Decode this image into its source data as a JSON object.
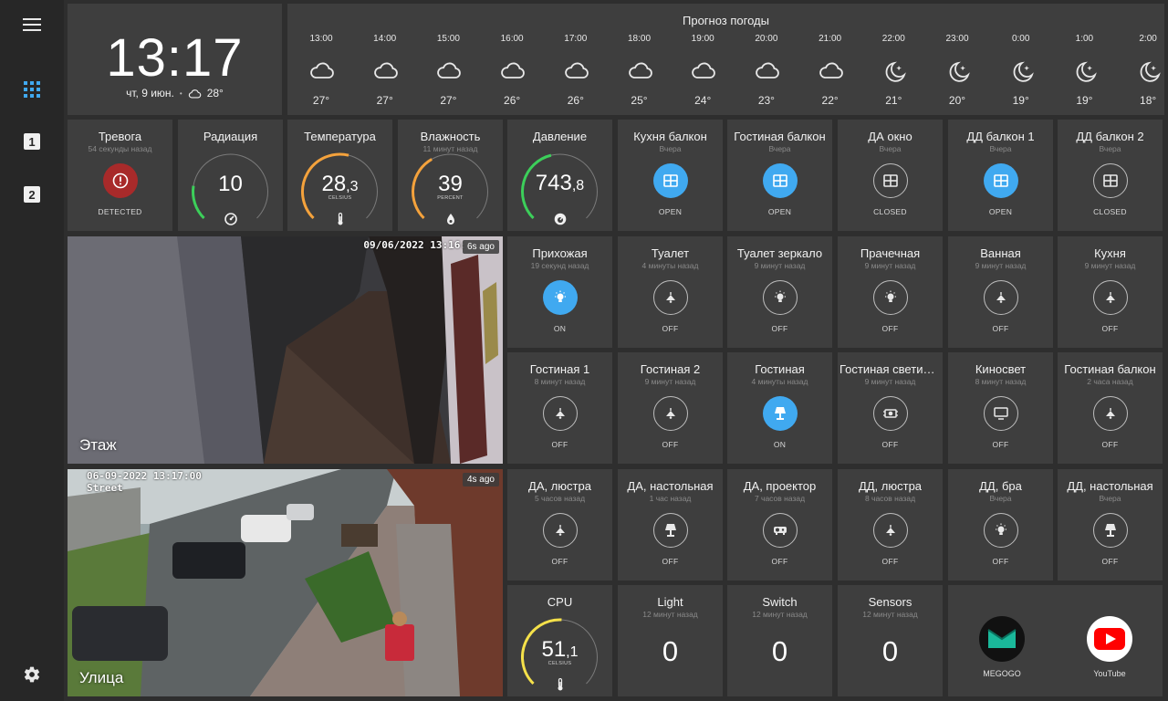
{
  "clock": {
    "time": "13:17",
    "date": "чт, 9 июн.",
    "temp": "28°"
  },
  "weather": {
    "title": "Прогноз погоды",
    "hours": [
      {
        "time": "13:00",
        "temp": "27°",
        "icon": "cloud"
      },
      {
        "time": "14:00",
        "temp": "27°",
        "icon": "cloud"
      },
      {
        "time": "15:00",
        "temp": "27°",
        "icon": "cloud"
      },
      {
        "time": "16:00",
        "temp": "26°",
        "icon": "cloud"
      },
      {
        "time": "17:00",
        "temp": "26°",
        "icon": "cloud"
      },
      {
        "time": "18:00",
        "temp": "25°",
        "icon": "cloud"
      },
      {
        "time": "19:00",
        "temp": "24°",
        "icon": "cloud"
      },
      {
        "time": "20:00",
        "temp": "23°",
        "icon": "cloud"
      },
      {
        "time": "21:00",
        "temp": "22°",
        "icon": "cloud"
      },
      {
        "time": "22:00",
        "temp": "21°",
        "icon": "moon"
      },
      {
        "time": "23:00",
        "temp": "20°",
        "icon": "moon"
      },
      {
        "time": "0:00",
        "temp": "19°",
        "icon": "moon"
      },
      {
        "time": "1:00",
        "temp": "19°",
        "icon": "moon"
      },
      {
        "time": "2:00",
        "temp": "18°",
        "icon": "moon"
      }
    ]
  },
  "sensors": {
    "alarm": {
      "title": "Тревога",
      "sub": "54 секунды назад",
      "state": "DETECTED"
    },
    "radiation": {
      "title": "Радиация",
      "value": "10",
      "level": 0.2
    },
    "temperature": {
      "title": "Температура",
      "value": "28",
      "decimal": ",3",
      "unit": "CELSIUS",
      "level": 0.55
    },
    "humidity": {
      "title": "Влажность",
      "sub": "11 минут назад",
      "value": "39",
      "unit": "PERCENT",
      "level": 0.39
    },
    "pressure": {
      "title": "Давление",
      "value": "743",
      "decimal": ",8",
      "level": 0.45
    },
    "cpu": {
      "title": "CPU",
      "value": "51",
      "decimal": ",1",
      "unit": "CELSIUS",
      "level": 0.51
    }
  },
  "windows": [
    {
      "title": "Кухня балкон",
      "sub": "Вчера",
      "state": "OPEN",
      "on": true
    },
    {
      "title": "Гостиная балкон",
      "sub": "Вчера",
      "state": "OPEN",
      "on": true
    },
    {
      "title": "ДА окно",
      "sub": "Вчера",
      "state": "CLOSED",
      "on": false
    },
    {
      "title": "ДД балкон 1",
      "sub": "Вчера",
      "state": "OPEN",
      "on": true
    },
    {
      "title": "ДД балкон 2",
      "sub": "Вчера",
      "state": "CLOSED",
      "on": false
    }
  ],
  "lights": [
    {
      "title": "Прихожая",
      "sub": "19 секунд назад",
      "state": "ON",
      "on": true,
      "icon": "bulb"
    },
    {
      "title": "Туалет",
      "sub": "4 минуты назад",
      "state": "OFF",
      "on": false,
      "icon": "ceiling"
    },
    {
      "title": "Туалет зеркало",
      "sub": "9 минут назад",
      "state": "OFF",
      "on": false,
      "icon": "bulb"
    },
    {
      "title": "Прачечная",
      "sub": "9 минут назад",
      "state": "OFF",
      "on": false,
      "icon": "bulb"
    },
    {
      "title": "Ванная",
      "sub": "9 минут назад",
      "state": "OFF",
      "on": false,
      "icon": "ceiling"
    },
    {
      "title": "Кухня",
      "sub": "9 минут назад",
      "state": "OFF",
      "on": false,
      "icon": "ceiling"
    },
    {
      "title": "Гостиная 1",
      "sub": "8 минут назад",
      "state": "OFF",
      "on": false,
      "icon": "ceiling"
    },
    {
      "title": "Гостиная 2",
      "sub": "9 минут назад",
      "state": "OFF",
      "on": false,
      "icon": "ceiling"
    },
    {
      "title": "Гостиная",
      "sub": "4 минуты назад",
      "state": "ON",
      "on": true,
      "icon": "lamp"
    },
    {
      "title": "Гостиная светильник",
      "sub": "9 минут назад",
      "state": "OFF",
      "on": false,
      "icon": "projector"
    },
    {
      "title": "Киносвет",
      "sub": "8 минут назад",
      "state": "OFF",
      "on": false,
      "icon": "tv"
    },
    {
      "title": "Гостиная балкон",
      "sub": "2 часа назад",
      "state": "OFF",
      "on": false,
      "icon": "ceiling"
    },
    {
      "title": "ДА, люстра",
      "sub": "5 часов назад",
      "state": "OFF",
      "on": false,
      "icon": "ceiling"
    },
    {
      "title": "ДА, настольная",
      "sub": "1 час назад",
      "state": "OFF",
      "on": false,
      "icon": "lamp"
    },
    {
      "title": "ДА, проектор",
      "sub": "7 часов назад",
      "state": "OFF",
      "on": false,
      "icon": "projector2"
    },
    {
      "title": "ДД, люстра",
      "sub": "8 часов назад",
      "state": "OFF",
      "on": false,
      "icon": "ceiling"
    },
    {
      "title": "ДД, бра",
      "sub": "Вчера",
      "state": "OFF",
      "on": false,
      "icon": "bulb"
    },
    {
      "title": "ДД, настольная",
      "sub": "Вчера",
      "state": "OFF",
      "on": false,
      "icon": "lamp"
    }
  ],
  "counters": [
    {
      "title": "Light",
      "sub": "12 минут назад",
      "value": "0"
    },
    {
      "title": "Switch",
      "sub": "12 минут назад",
      "value": "0"
    },
    {
      "title": "Sensors",
      "sub": "12 минут назад",
      "value": "0"
    }
  ],
  "apps": [
    {
      "name": "MEGOGO",
      "color": "#111111"
    },
    {
      "name": "YouTube",
      "color": "#ffffff"
    }
  ],
  "cameras": {
    "floor": {
      "label": "Этаж",
      "timestamp": "09/06/2022 13:16:",
      "ago": "6s ago"
    },
    "street": {
      "label": "Улица",
      "timestamp": "06-09-2022 13:17:00",
      "caption": "Street",
      "ago": "4s ago"
    }
  },
  "colors": {
    "accent": "#40a9f0",
    "alarm": "#a82a2a",
    "card": "#3e3e3e",
    "bg": "#2e2e2e",
    "gauge_yellow": "#f5e14a",
    "gauge_orange": "#f4a23c",
    "gauge_green": "#3ccf5a"
  }
}
